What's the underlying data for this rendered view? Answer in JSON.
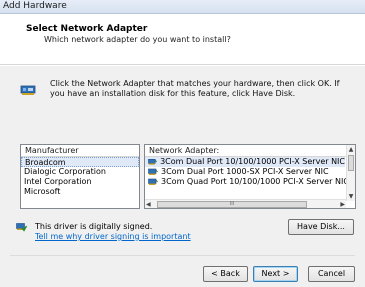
{
  "window": {
    "title": "Add Hardware"
  },
  "header": {
    "title": "Select Network Adapter",
    "subtitle": "Which network adapter do you want to install?"
  },
  "instructions": {
    "text": "Click the Network Adapter that matches your hardware, then click OK. If you have an installation disk for this feature, click Have Disk."
  },
  "manufacturer": {
    "header": "Manufacturer",
    "items": [
      "Broadcom",
      "Dialogic Corporation",
      "Intel Corporation",
      "Microsoft"
    ],
    "selected_index": 0
  },
  "adapters": {
    "header": "Network Adapter:",
    "items": [
      "3Com Dual Port 10/100/1000 PCI-X Server NIC",
      "3Com Dual Port 1000-SX PCI-X Server NIC",
      "3Com Quad Port 10/100/1000 PCI-X Server NIC"
    ],
    "selected_index": 0,
    "hscroll_grip": "III"
  },
  "signature": {
    "status": "This driver is digitally signed.",
    "link": "Tell me why driver signing is important"
  },
  "buttons": {
    "have_disk": "Have Disk...",
    "back": "< Back",
    "next": "Next >",
    "cancel": "Cancel"
  }
}
